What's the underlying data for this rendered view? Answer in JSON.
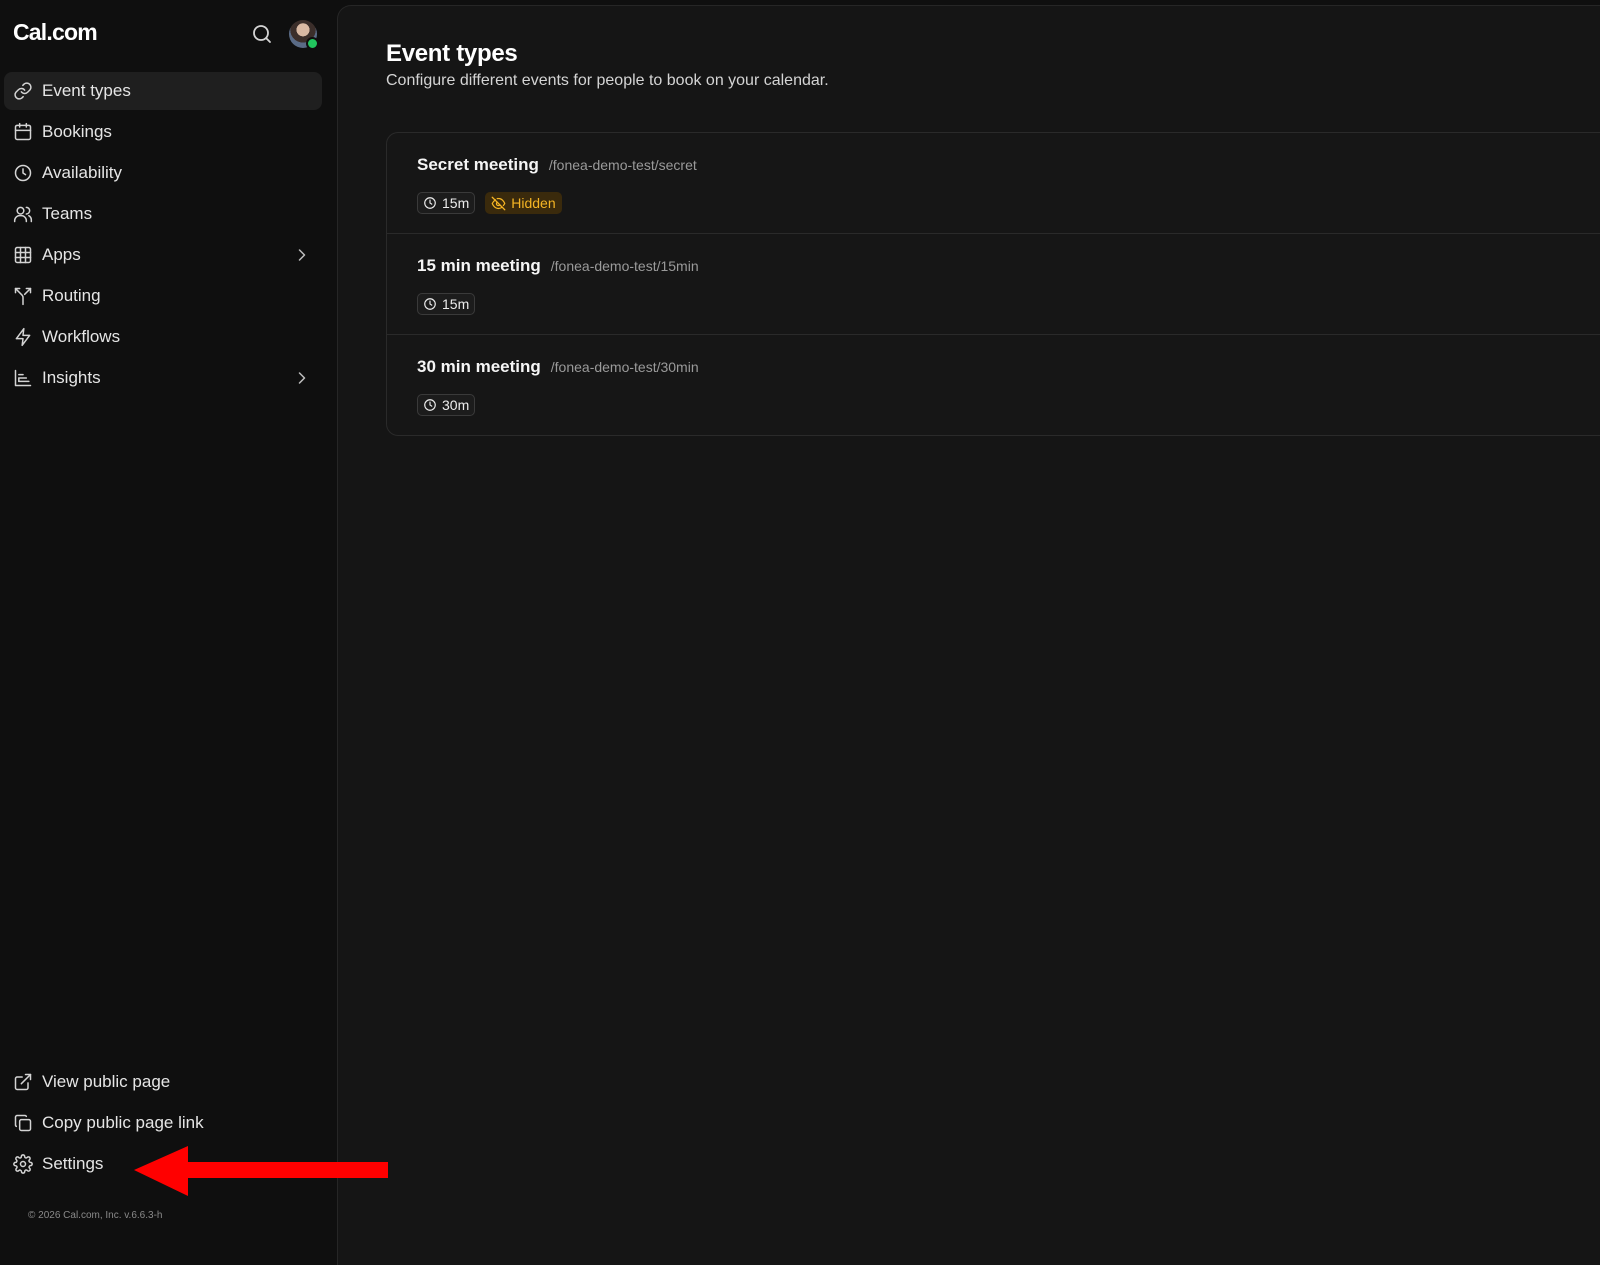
{
  "brand": {
    "logo_text": "Cal.com"
  },
  "sidebar": {
    "items": [
      {
        "label": "Event types",
        "icon": "link-icon",
        "active": true
      },
      {
        "label": "Bookings",
        "icon": "calendar-icon"
      },
      {
        "label": "Availability",
        "icon": "clock-icon"
      },
      {
        "label": "Teams",
        "icon": "users-icon"
      },
      {
        "label": "Apps",
        "icon": "grid-icon",
        "expandable": true
      },
      {
        "label": "Routing",
        "icon": "split-icon"
      },
      {
        "label": "Workflows",
        "icon": "zap-icon"
      },
      {
        "label": "Insights",
        "icon": "bar-chart-icon",
        "expandable": true
      }
    ],
    "bottom_items": [
      {
        "label": "View public page",
        "icon": "external-link-icon"
      },
      {
        "label": "Copy public page link",
        "icon": "copy-icon"
      },
      {
        "label": "Settings",
        "icon": "gear-icon"
      }
    ],
    "copyright": "© 2026 Cal.com, Inc. v.6.6.3-h"
  },
  "main": {
    "title": "Event types",
    "subtitle": "Configure different events for people to book on your calendar.",
    "events": [
      {
        "title": "Secret meeting",
        "slug": "/fonea-demo-test/secret",
        "duration": "15m",
        "hidden_label": "Hidden"
      },
      {
        "title": "15 min meeting",
        "slug": "/fonea-demo-test/15min",
        "duration": "15m"
      },
      {
        "title": "30 min meeting",
        "slug": "/fonea-demo-test/30min",
        "duration": "30m"
      }
    ]
  },
  "colors": {
    "background": "#0f0f0f",
    "panel": "#151515",
    "hidden_badge_text": "#f5b524",
    "status_online": "#22c55e",
    "annotation_arrow": "#ff0000"
  }
}
